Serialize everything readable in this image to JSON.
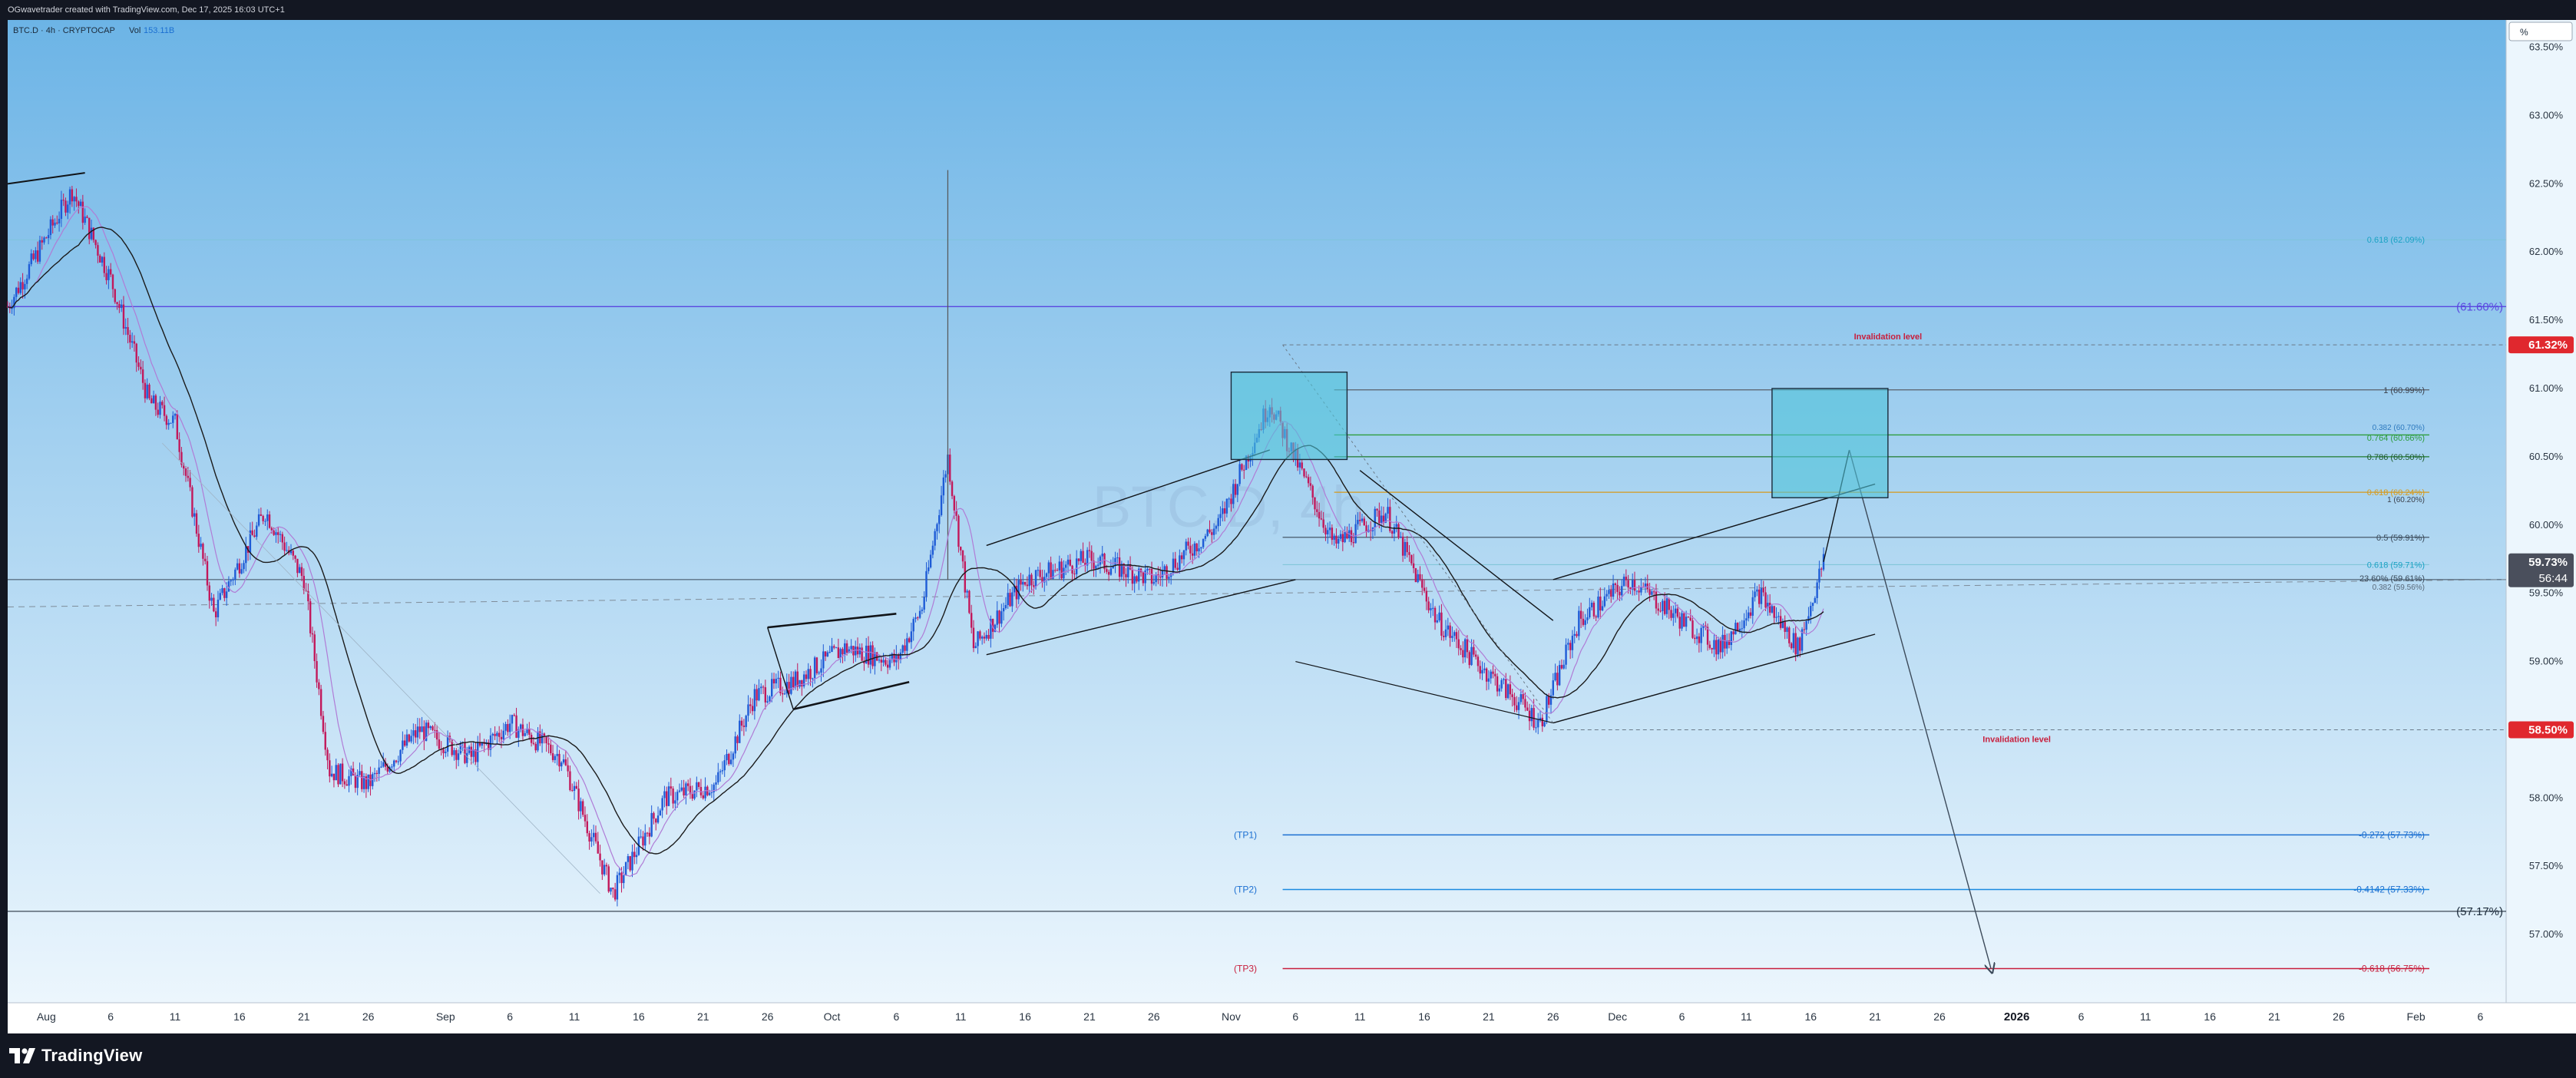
{
  "header": {
    "credit": "OGwavetrader created with TradingView.com, Dec 17, 2025 16:03 UTC+1"
  },
  "footer": {
    "brand": "TradingView"
  },
  "symbol": {
    "name": "BTC.D · 4h · CRYPTOCAP",
    "vol_label": "Vol",
    "vol_value": "153.11B",
    "watermark": "BTC.D, 4h"
  },
  "axis": {
    "scale_button": "%",
    "price_labels": [
      "63.50%",
      "63.00%",
      "62.50%",
      "62.00%",
      "61.50%",
      "61.00%",
      "60.50%",
      "60.00%",
      "59.50%",
      "59.00%",
      "58.50%",
      "58.00%",
      "57.50%",
      "57.00%"
    ],
    "date_labels": [
      "Aug",
      "6",
      "11",
      "16",
      "21",
      "26",
      "Sep",
      "6",
      "11",
      "16",
      "21",
      "26",
      "Oct",
      "6",
      "11",
      "16",
      "21",
      "26",
      "Nov",
      "6",
      "11",
      "16",
      "21",
      "26",
      "Dec",
      "6",
      "11",
      "16",
      "21",
      "26",
      "2026",
      "6",
      "11",
      "16",
      "21",
      "26",
      "Feb",
      "6"
    ],
    "bold_dates": [
      "2026"
    ]
  },
  "price_tags": {
    "invalidation_high": "61.32%",
    "current": "59.73%",
    "countdown": "56:44",
    "invalidation_low": "58.50%"
  },
  "annotations": {
    "invalidation_top": "Invalidation level",
    "invalidation_bottom": "Invalidation level",
    "tp1": "(TP1)",
    "tp2": "(TP2)",
    "tp3": "(TP3)",
    "tp1_fib": "-0.272 (57.73%)",
    "tp2_fib": "-0.4142 (57.33%)",
    "tp3_fib": "-0.618 (56.75%)",
    "level_6160": "(61.60%)",
    "level_5717": "(57.17%)",
    "fib_0618_top": "0.618 (62.09%)",
    "fib_1_top": "1 (60.99%)",
    "fib_0382": "0.382 (60.70%)",
    "fib_0764": "0.764 (60.66%)",
    "fib_0786": "0.786 (60.50%)",
    "fib_0618_mid": "0.618 (60.24%)",
    "fib_1_mid": "1 (60.20%)",
    "fib_05": "0.5 (59.91%)",
    "fib_0618_low": "0.618 (59.71%)",
    "fib_2360": "23.60% (59.61%)",
    "fib_0382_low": "0.382 (59.56%)"
  },
  "colors": {
    "background_top": "#6cb4e6",
    "background_bottom": "#ecf6fd",
    "candle_up": "#1e5bd6",
    "candle_down": "#c2185b",
    "ma_black": "#1b1b1b",
    "ma_purple": "#b07cd6",
    "tag_red": "#e0282e",
    "tag_dark": "#4a4f5c",
    "fib_cyan": "#1aa2c4",
    "fib_green": "#2e9d3e",
    "fib_orange": "#d69a1c",
    "tp_blue": "#1b6fd1",
    "tp_red": "#c81e3c",
    "purple_level": "#5a47e0",
    "box_fill": "#4fc3d9"
  },
  "chart_data": {
    "type": "candlestick",
    "title": "BTC.D · 4h · CRYPTOCAP",
    "y_unit": "%",
    "y_range": [
      56.5,
      63.7
    ],
    "x_range": [
      "2025-07-29",
      "2026-02-08"
    ],
    "price_levels": [
      {
        "label": "Invalidation level",
        "value": 61.32
      },
      {
        "label": "Invalidation level",
        "value": 58.5
      },
      {
        "label": "(TP1)",
        "value": 57.73
      },
      {
        "label": "(TP2)",
        "value": 57.33
      },
      {
        "label": "(TP3)",
        "value": 56.75
      },
      {
        "label": "(61.60%)",
        "value": 61.6
      },
      {
        "label": "(57.17%)",
        "value": 57.17
      }
    ],
    "close_path": [
      [
        "2025-07-29",
        61.6
      ],
      [
        "2025-08-03",
        62.45
      ],
      [
        "2025-08-06",
        61.8
      ],
      [
        "2025-08-09",
        60.9
      ],
      [
        "2025-08-11",
        60.75
      ],
      [
        "2025-08-14",
        59.35
      ],
      [
        "2025-08-18",
        60.1
      ],
      [
        "2025-08-21",
        59.6
      ],
      [
        "2025-08-23",
        58.2
      ],
      [
        "2025-08-26",
        58.1
      ],
      [
        "2025-08-30",
        58.5
      ],
      [
        "2025-09-03",
        58.3
      ],
      [
        "2025-09-06",
        58.55
      ],
      [
        "2025-09-10",
        58.3
      ],
      [
        "2025-09-14",
        57.3
      ],
      [
        "2025-09-18",
        58.0
      ],
      [
        "2025-09-22",
        58.1
      ],
      [
        "2025-09-25",
        58.75
      ],
      [
        "2025-09-28",
        58.85
      ],
      [
        "2025-10-02",
        59.1
      ],
      [
        "2025-10-06",
        59.0
      ],
      [
        "2025-10-08",
        59.4
      ],
      [
        "2025-10-10",
        60.5
      ],
      [
        "2025-10-12",
        59.1
      ],
      [
        "2025-10-16",
        59.6
      ],
      [
        "2025-10-21",
        59.75
      ],
      [
        "2025-10-26",
        59.6
      ],
      [
        "2025-10-31",
        60.0
      ],
      [
        "2025-11-04",
        60.9
      ],
      [
        "2025-11-09",
        59.85
      ],
      [
        "2025-11-13",
        60.1
      ],
      [
        "2025-11-17",
        59.3
      ],
      [
        "2025-11-20",
        59.0
      ],
      [
        "2025-11-25",
        58.55
      ],
      [
        "2025-11-28",
        59.3
      ],
      [
        "2025-12-02",
        59.6
      ],
      [
        "2025-12-06",
        59.3
      ],
      [
        "2025-12-09",
        59.1
      ],
      [
        "2025-12-12",
        59.5
      ],
      [
        "2025-12-15",
        59.1
      ],
      [
        "2025-12-17",
        59.73
      ]
    ]
  }
}
